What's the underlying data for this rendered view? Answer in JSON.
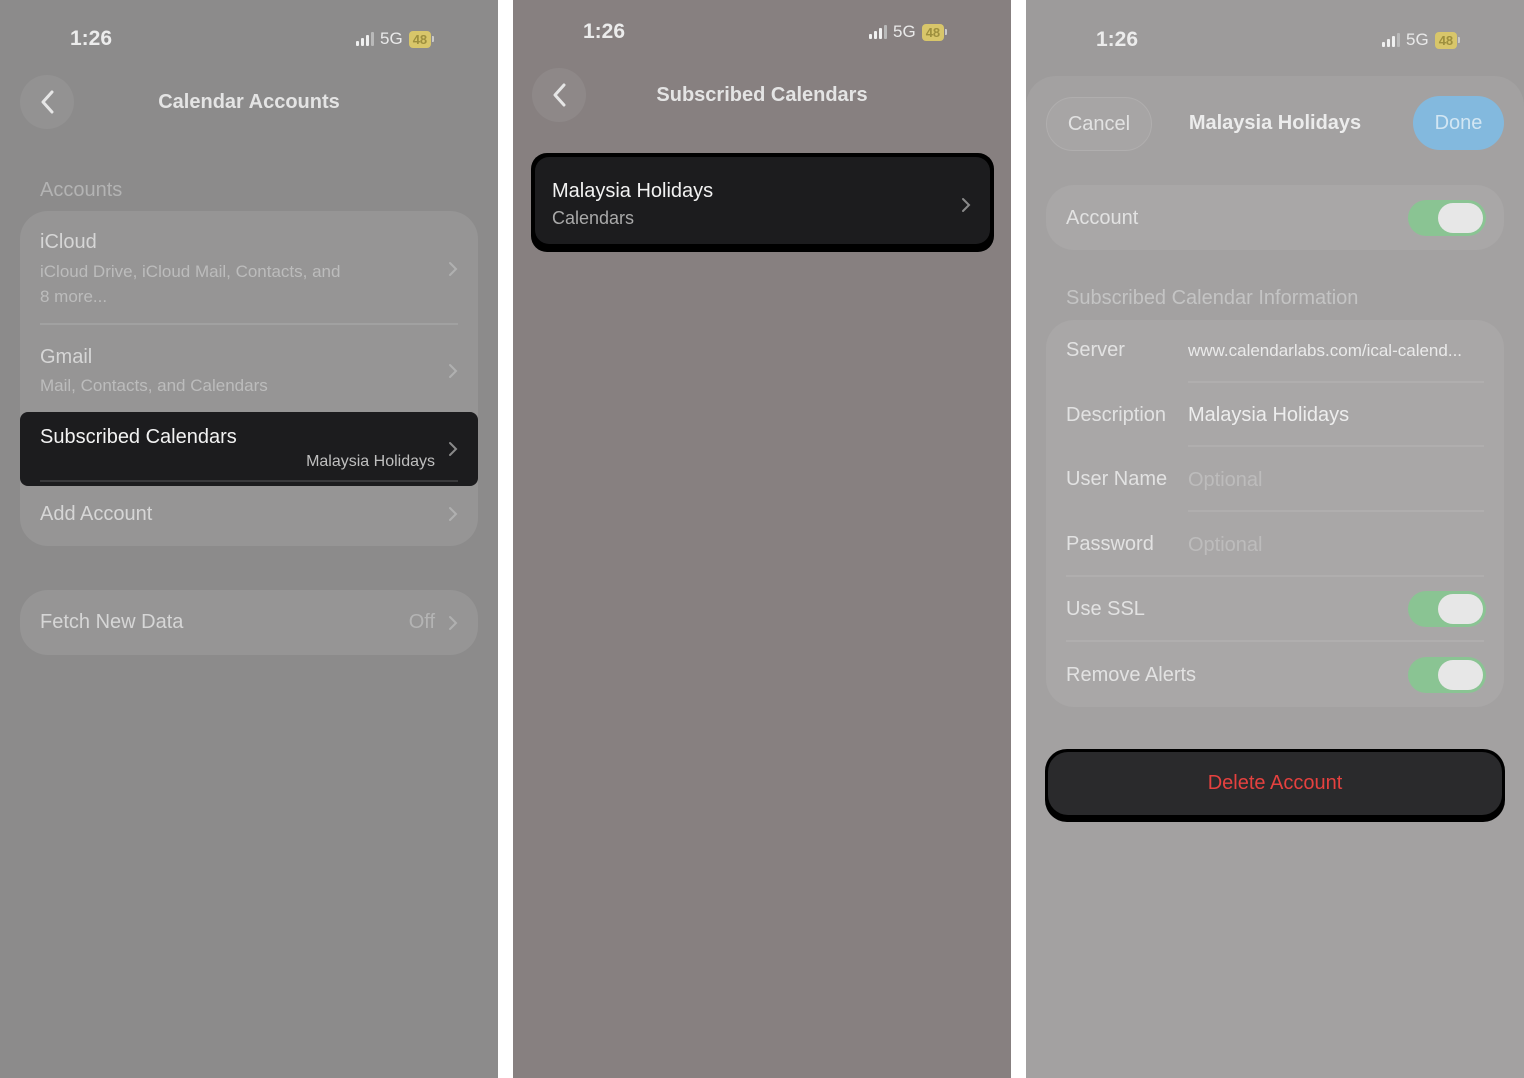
{
  "panel1": {
    "status": {
      "time": "1:26",
      "network": "5G",
      "battery": "48"
    },
    "nav": {
      "title": "Calendar Accounts",
      "back_icon": "chevron-left-icon"
    },
    "accounts_header": "Accounts",
    "accounts": [
      {
        "title": "iCloud",
        "subtitle_line1": "iCloud Drive, iCloud Mail, Contacts, and",
        "subtitle_line2": "8 more..."
      },
      {
        "title": "Gmail",
        "subtitle": "Mail, Contacts, and Calendars"
      },
      {
        "title": "Subscribed Calendars",
        "detail": "Malaysia Holidays"
      },
      {
        "title": "Add Account"
      }
    ],
    "fetch": {
      "label": "Fetch New Data",
      "value": "Off"
    }
  },
  "panel2": {
    "status": {
      "time": "1:26",
      "network": "5G",
      "battery": "48"
    },
    "nav": {
      "title": "Subscribed Calendars",
      "back_icon": "chevron-left-icon"
    },
    "item": {
      "title": "Malaysia Holidays",
      "subtitle": "Calendars"
    }
  },
  "panel3": {
    "status": {
      "time": "1:26",
      "network": "5G",
      "battery": "48"
    },
    "header": {
      "cancel": "Cancel",
      "title": "Malaysia Holidays",
      "done": "Done"
    },
    "account": {
      "label": "Account",
      "enabled": true
    },
    "info_header": "Subscribed Calendar Information",
    "fields": {
      "server": {
        "label": "Server",
        "value": "www.calendarlabs.com/ical-calend..."
      },
      "description": {
        "label": "Description",
        "value": "Malaysia Holidays"
      },
      "username": {
        "label": "User Name",
        "placeholder": "Optional"
      },
      "password": {
        "label": "Password",
        "placeholder": "Optional"
      }
    },
    "use_ssl": {
      "label": "Use SSL",
      "enabled": true
    },
    "remove_alerts": {
      "label": "Remove Alerts",
      "enabled": true
    },
    "delete": {
      "label": "Delete Account"
    }
  },
  "colors": {
    "highlight": "#1c1c1e",
    "toggle_on": "#8ac493",
    "done_button": "#83b9de",
    "delete_text": "#e5413f"
  }
}
